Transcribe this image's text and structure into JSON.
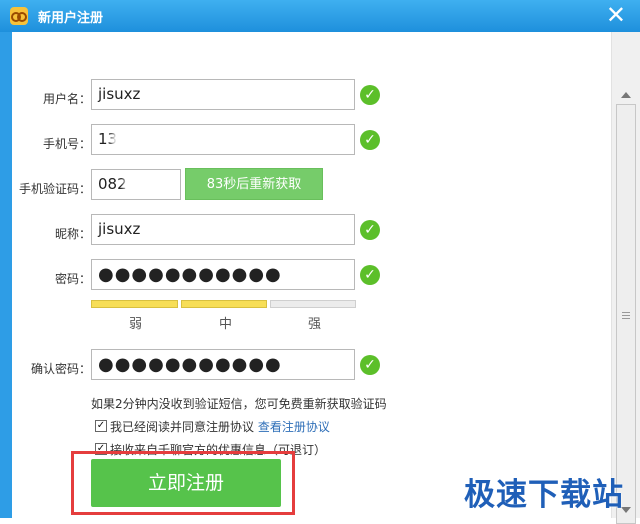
{
  "window": {
    "title": "新用户注册",
    "close_symbol": "✕"
  },
  "form": {
    "username_label": "用户名：",
    "username_value": "jisuxz",
    "phone_label": "手机号：",
    "phone_value": "13",
    "code_label": "手机验证码：",
    "code_value": "082",
    "resend_label": "83秒后重新获取",
    "nickname_label": "昵称：",
    "nickname_value": "jisuxz",
    "password_label": "密码：",
    "password_value": "●●●●●●●●●●●",
    "strength_labels": [
      "弱",
      "中",
      "强"
    ],
    "confirm_label": "确认密码：",
    "confirm_value": "●●●●●●●●●●●",
    "note": "如果2分钟内没收到验证短信，您可免费重新获取验证码",
    "agreement_text": "我已经阅读并同意注册协议",
    "agreement_link": "查看注册协议",
    "offers_text": "接收来自千聊官方的优惠信息（可退订）",
    "register_label": "立即注册",
    "valid_mark": "✓"
  },
  "watermark": "极速下载站",
  "colors": {
    "title_blue": "#1e90dc",
    "success_green": "#5cbf2a",
    "button_green": "#56c34b",
    "highlight_red": "#e53d3d"
  }
}
